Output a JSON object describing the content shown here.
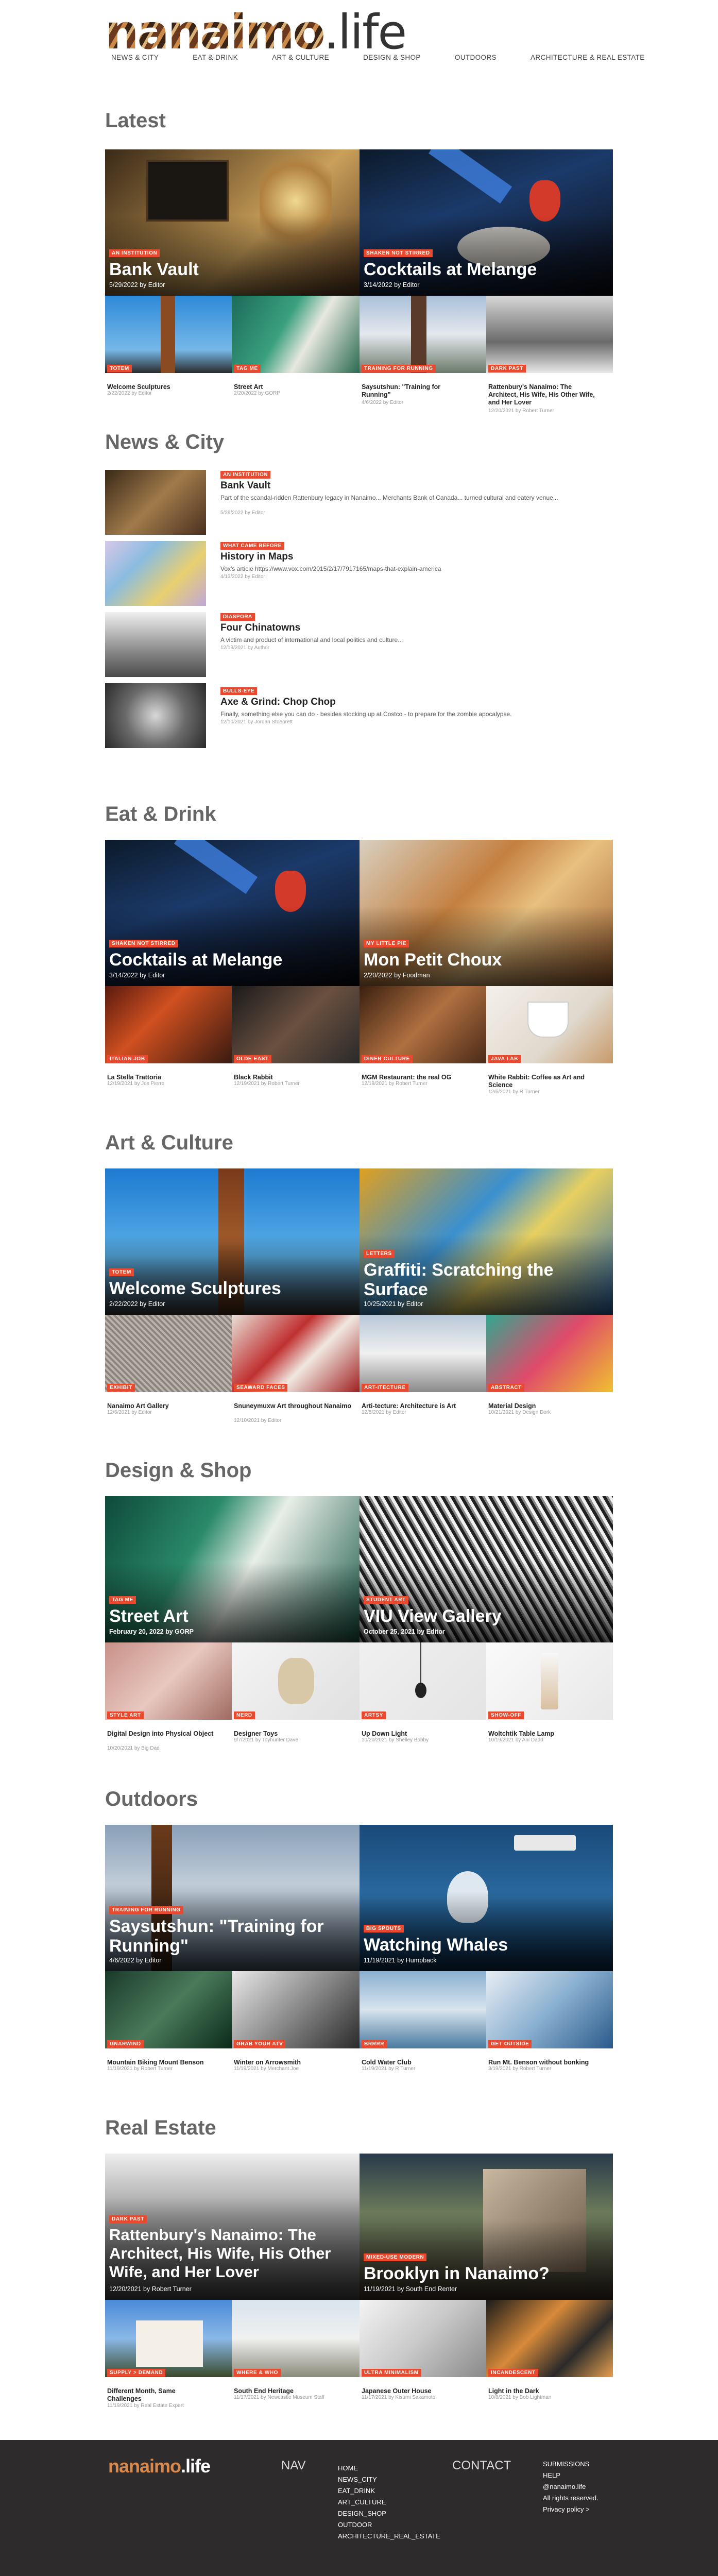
{
  "header": {
    "logo_part1": "nanaimo",
    "logo_part2": ".life",
    "nav": [
      "NEWS & CITY",
      "EAT & DRINK",
      "ART & CULTURE",
      "DESIGN & SHOP",
      "OUTDOORS",
      "ARCHITECTURE & REAL ESTATE"
    ]
  },
  "sections": {
    "latest": "Latest",
    "news": "News & City",
    "eat": "Eat & Drink",
    "art": "Art & Culture",
    "design": "Design & Shop",
    "outdoors": "Outdoors",
    "realestate": "Real Estate"
  },
  "latest": {
    "features": [
      {
        "tag": "AN INSTITUTION",
        "title": "Bank Vault",
        "meta": "5/29/2022 by Editor"
      },
      {
        "tag": "SHAKEN NOT STIRRED",
        "title": "Cocktails at Melange",
        "meta": "3/14/2022 by Editor"
      }
    ],
    "cards": [
      {
        "tag": "TOTEM",
        "title": "Welcome Sculptures",
        "meta": "2/22/2022 by Editor"
      },
      {
        "tag": "TAG ME",
        "title": "Street Art",
        "meta": "2/20/2022 by GORP"
      },
      {
        "tag": "TRAINING FOR RUNNING",
        "title": "Saysutshun: \"Training for Running\"",
        "meta": "4/6/2022 by Editor"
      },
      {
        "tag": "DARK PAST",
        "title": "Rattenbury's Nanaimo: The Architect, His Wife, His Other Wife, and Her Lover",
        "meta": "12/20/2021 by Robert Turner"
      }
    ]
  },
  "news": [
    {
      "tag": "AN INSTITUTION",
      "title": "Bank Vault",
      "excerpt": "Part of the scandal-ridden Rattenbury legacy in Nanaimo... Merchants Bank of Canada... turned cultural and eatery venue...",
      "meta": "5/29/2022 by Editor"
    },
    {
      "tag": "WHAT CAME BEFORE",
      "title": "History in Maps",
      "excerpt": "Vox's article https://www.vox.com/2015/2/17/7917165/maps-that-explain-america",
      "meta": "4/13/2022 by Editor"
    },
    {
      "tag": "DIASPORA",
      "title": "Four Chinatowns",
      "excerpt": "A victim and product of international and local politics and culture...",
      "meta": "12/19/2021 by Author"
    },
    {
      "tag": "BULLS-EYE",
      "title": "Axe & Grind: Chop Chop",
      "excerpt": "Finally, something else you can do - besides stocking up at Costco - to prepare for the zombie apocalypse.",
      "meta": "12/10/2021 by Jordan Stoeprett"
    }
  ],
  "eat": {
    "features": [
      {
        "tag": "SHAKEN NOT STIRRED",
        "title": "Cocktails at Melange",
        "meta": "3/14/2022 by Editor"
      },
      {
        "tag": "MY LITTLE PIE",
        "title": "Mon Petit Choux",
        "meta": "2/20/2022 by Foodman"
      }
    ],
    "cards": [
      {
        "tag": "ITALIAN JOB",
        "title": "La Stella Trattoria",
        "meta": "12/19/2021 by Jos Pierre"
      },
      {
        "tag": "OLDE EAST",
        "title": "Black Rabbit",
        "meta": "12/19/2021 by Robert Turner"
      },
      {
        "tag": "DINER CULTURE",
        "title": "MGM Restaurant: the real OG",
        "meta": "12/19/2021 by Robert Turner"
      },
      {
        "tag": "JAVA LAB",
        "title": "White Rabbit: Coffee as Art and Science",
        "meta": "12/6/2021 by R Turner"
      }
    ]
  },
  "art": {
    "features": [
      {
        "tag": "TOTEM",
        "title": "Welcome Sculptures",
        "meta": "2/22/2022 by Editor"
      },
      {
        "tag": "LETTERS",
        "title": "Graffiti: Scratching the Surface",
        "meta": "10/25/2021 by Editor"
      }
    ],
    "cards": [
      {
        "tag": "EXHIBIT",
        "title": "Nanaimo Art Gallery",
        "meta": "12/6/2021 by Editor"
      },
      {
        "tag": "SEAWARD FACES",
        "title": "Snuneymuxw Art throughout Nanaimo",
        "meta": "12/10/2021 by Editor"
      },
      {
        "tag": "ART-ITECTURE",
        "title": "Arti-tecture: Architecture is Art",
        "meta": "12/5/2021 by Editor"
      },
      {
        "tag": "ABSTRACT",
        "title": "Material Design",
        "meta": "10/21/2021 by Design Dork"
      }
    ]
  },
  "design": {
    "features": [
      {
        "tag": "TAG ME",
        "title": "Street Art",
        "meta": "February 20, 2022 by GORP"
      },
      {
        "tag": "STUDENT ART",
        "title": "VIU View Gallery",
        "meta": "October 25, 2021 by Editor"
      }
    ],
    "cards": [
      {
        "tag": "STYLE ART",
        "title": "Digital Design into Physical Object",
        "meta": "10/20/2021 by Big Dad"
      },
      {
        "tag": "NERD",
        "title": "Designer Toys",
        "meta": "9/7/2021 by Toyhunter Dave"
      },
      {
        "tag": "ARTSY",
        "title": "Up Down Light",
        "meta": "10/20/2021 by Shelley Bobby"
      },
      {
        "tag": "SHOW-OFF",
        "title": "Woltchtik Table Lamp",
        "meta": "10/19/2021 by Ani Dadd"
      }
    ]
  },
  "outdoors": {
    "features": [
      {
        "tag": "TRAINING FOR RUNNING",
        "title": "Saysutshun: \"Training for Running\"",
        "meta": "4/6/2022 by Editor"
      },
      {
        "tag": "BIG SPOUTS",
        "title": "Watching Whales",
        "meta": "11/19/2021 by Humpback"
      }
    ],
    "cards": [
      {
        "tag": "GNARWIND",
        "title": "Mountain Biking Mount Benson",
        "meta": "11/19/2021 by Robert Turner"
      },
      {
        "tag": "GRAB YOUR ATV",
        "title": "Winter on Arrowsmith",
        "meta": "11/19/2021 by Merchant Joe"
      },
      {
        "tag": "BRRRR",
        "title": "Cold Water Club",
        "meta": "11/19/2021 by R Turner"
      },
      {
        "tag": "GET OUTSIDE",
        "title": "Run Mt. Benson without bonking",
        "meta": "3/19/2021 by Robert Turner"
      }
    ]
  },
  "realestate": {
    "features": [
      {
        "tag": "DARK PAST",
        "title": "Rattenbury's Nanaimo: The Architect, His Wife, His Other Wife, and Her Lover",
        "meta": "12/20/2021 by Robert Turner"
      },
      {
        "tag": "MIXED-USE MODERN",
        "title": "Brooklyn in Nanaimo?",
        "meta": "11/19/2021 by South End Renter"
      }
    ],
    "cards": [
      {
        "tag": "SUPPLY > DEMAND",
        "title": "Different Month, Same Challenges",
        "meta": "11/19/2021 by Real Estate Expert"
      },
      {
        "tag": "WHERE & WHO",
        "title": "South End Heritage",
        "meta": "11/17/2021 by Newcastle Museum Staff"
      },
      {
        "tag": "ULTRA MINIMALISM",
        "title": "Japanese Outer House",
        "meta": "11/17/2021 by Kisumi Sakamoto"
      },
      {
        "tag": "INCANDESCENT",
        "title": "Light in the Dark",
        "meta": "10/8/2021 by Bob Lightman"
      }
    ]
  },
  "footer": {
    "logo_part1": "nanaimo",
    "logo_part2": ".life",
    "nav_head": "NAV",
    "nav_links": [
      "HOME",
      "NEWS_CITY",
      "EAT_DRINK",
      "ART_CULTURE",
      "DESIGN_SHOP",
      "OUTDOOR",
      "ARCHITECTURE_REAL_ESTATE"
    ],
    "contact_head": "CONTACT",
    "contact_links": [
      "SUBMISSIONS",
      "HELP",
      "@nanaimo.life",
      "All rights reserved.",
      "Privacy policy >"
    ]
  }
}
